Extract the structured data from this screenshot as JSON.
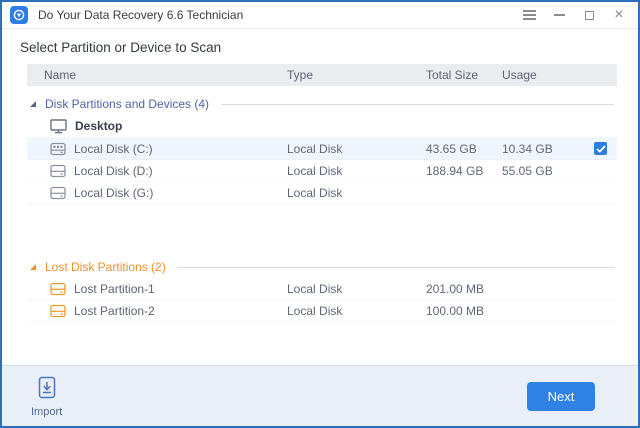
{
  "window": {
    "title": "Do Your Data Recovery 6.6 Technician",
    "controls": [
      {
        "name": "menu"
      },
      {
        "name": "minimize"
      },
      {
        "name": "maximize"
      },
      {
        "name": "close"
      }
    ]
  },
  "heading": "Select Partition or Device to Scan",
  "table": {
    "columns": [
      "Name",
      "Type",
      "Total Size",
      "Usage"
    ]
  },
  "sections": [
    {
      "id": "disk-partitions-and-devices",
      "label": "Disk Partitions and Devices (4)",
      "color": "#5163ae",
      "arrow_color": "#5a6584",
      "items": [
        {
          "name": "Desktop",
          "icon": "desktop-icon",
          "icon_color": "dark",
          "bold": true,
          "type": "",
          "total_size": "",
          "usage": "",
          "selected": false,
          "checked": false
        },
        {
          "name": "Local Disk (C:)",
          "icon": "system-drive-icon",
          "icon_color": "gray",
          "bold": false,
          "type": "Local Disk",
          "total_size": "43.65 GB",
          "usage": "10.34 GB",
          "selected": true,
          "checked": true
        },
        {
          "name": "Local Disk (D:)",
          "icon": "drive-icon",
          "icon_color": "gray",
          "bold": false,
          "type": "Local Disk",
          "total_size": "188.94 GB",
          "usage": "55.05 GB",
          "selected": false,
          "checked": false
        },
        {
          "name": "Local Disk (G:)",
          "icon": "drive-icon",
          "icon_color": "gray",
          "bold": false,
          "type": "Local Disk",
          "total_size": "",
          "usage": "",
          "selected": false,
          "checked": false
        }
      ]
    },
    {
      "id": "lost-disk-partitions",
      "label": "Lost Disk Partitions (2)",
      "color": "#ef9226",
      "arrow_color": "#ef9226",
      "gap_before": 52,
      "items": [
        {
          "name": "Lost Partition-1",
          "icon": "lost-drive-icon",
          "icon_color": "orange",
          "bold": false,
          "type": "Local Disk",
          "total_size": "201.00 MB",
          "usage": "",
          "selected": false,
          "checked": false
        },
        {
          "name": "Lost Partition-2",
          "icon": "lost-drive-icon",
          "icon_color": "orange",
          "bold": false,
          "type": "Local Disk",
          "total_size": "100.00 MB",
          "usage": "",
          "selected": false,
          "checked": false
        }
      ]
    }
  ],
  "footer": {
    "import_label": "Import",
    "next_label": "Next"
  },
  "colors": {
    "accent": "#2f82e4",
    "checkbox": "#2d7ce0",
    "selected_row": "#f0f6fd",
    "window_border": "#2d6fbd",
    "section_blue": "#5163ae",
    "lost_orange": "#ef9226",
    "header_bg": "#eaedf0",
    "footer_bg": "#e9eef7"
  }
}
